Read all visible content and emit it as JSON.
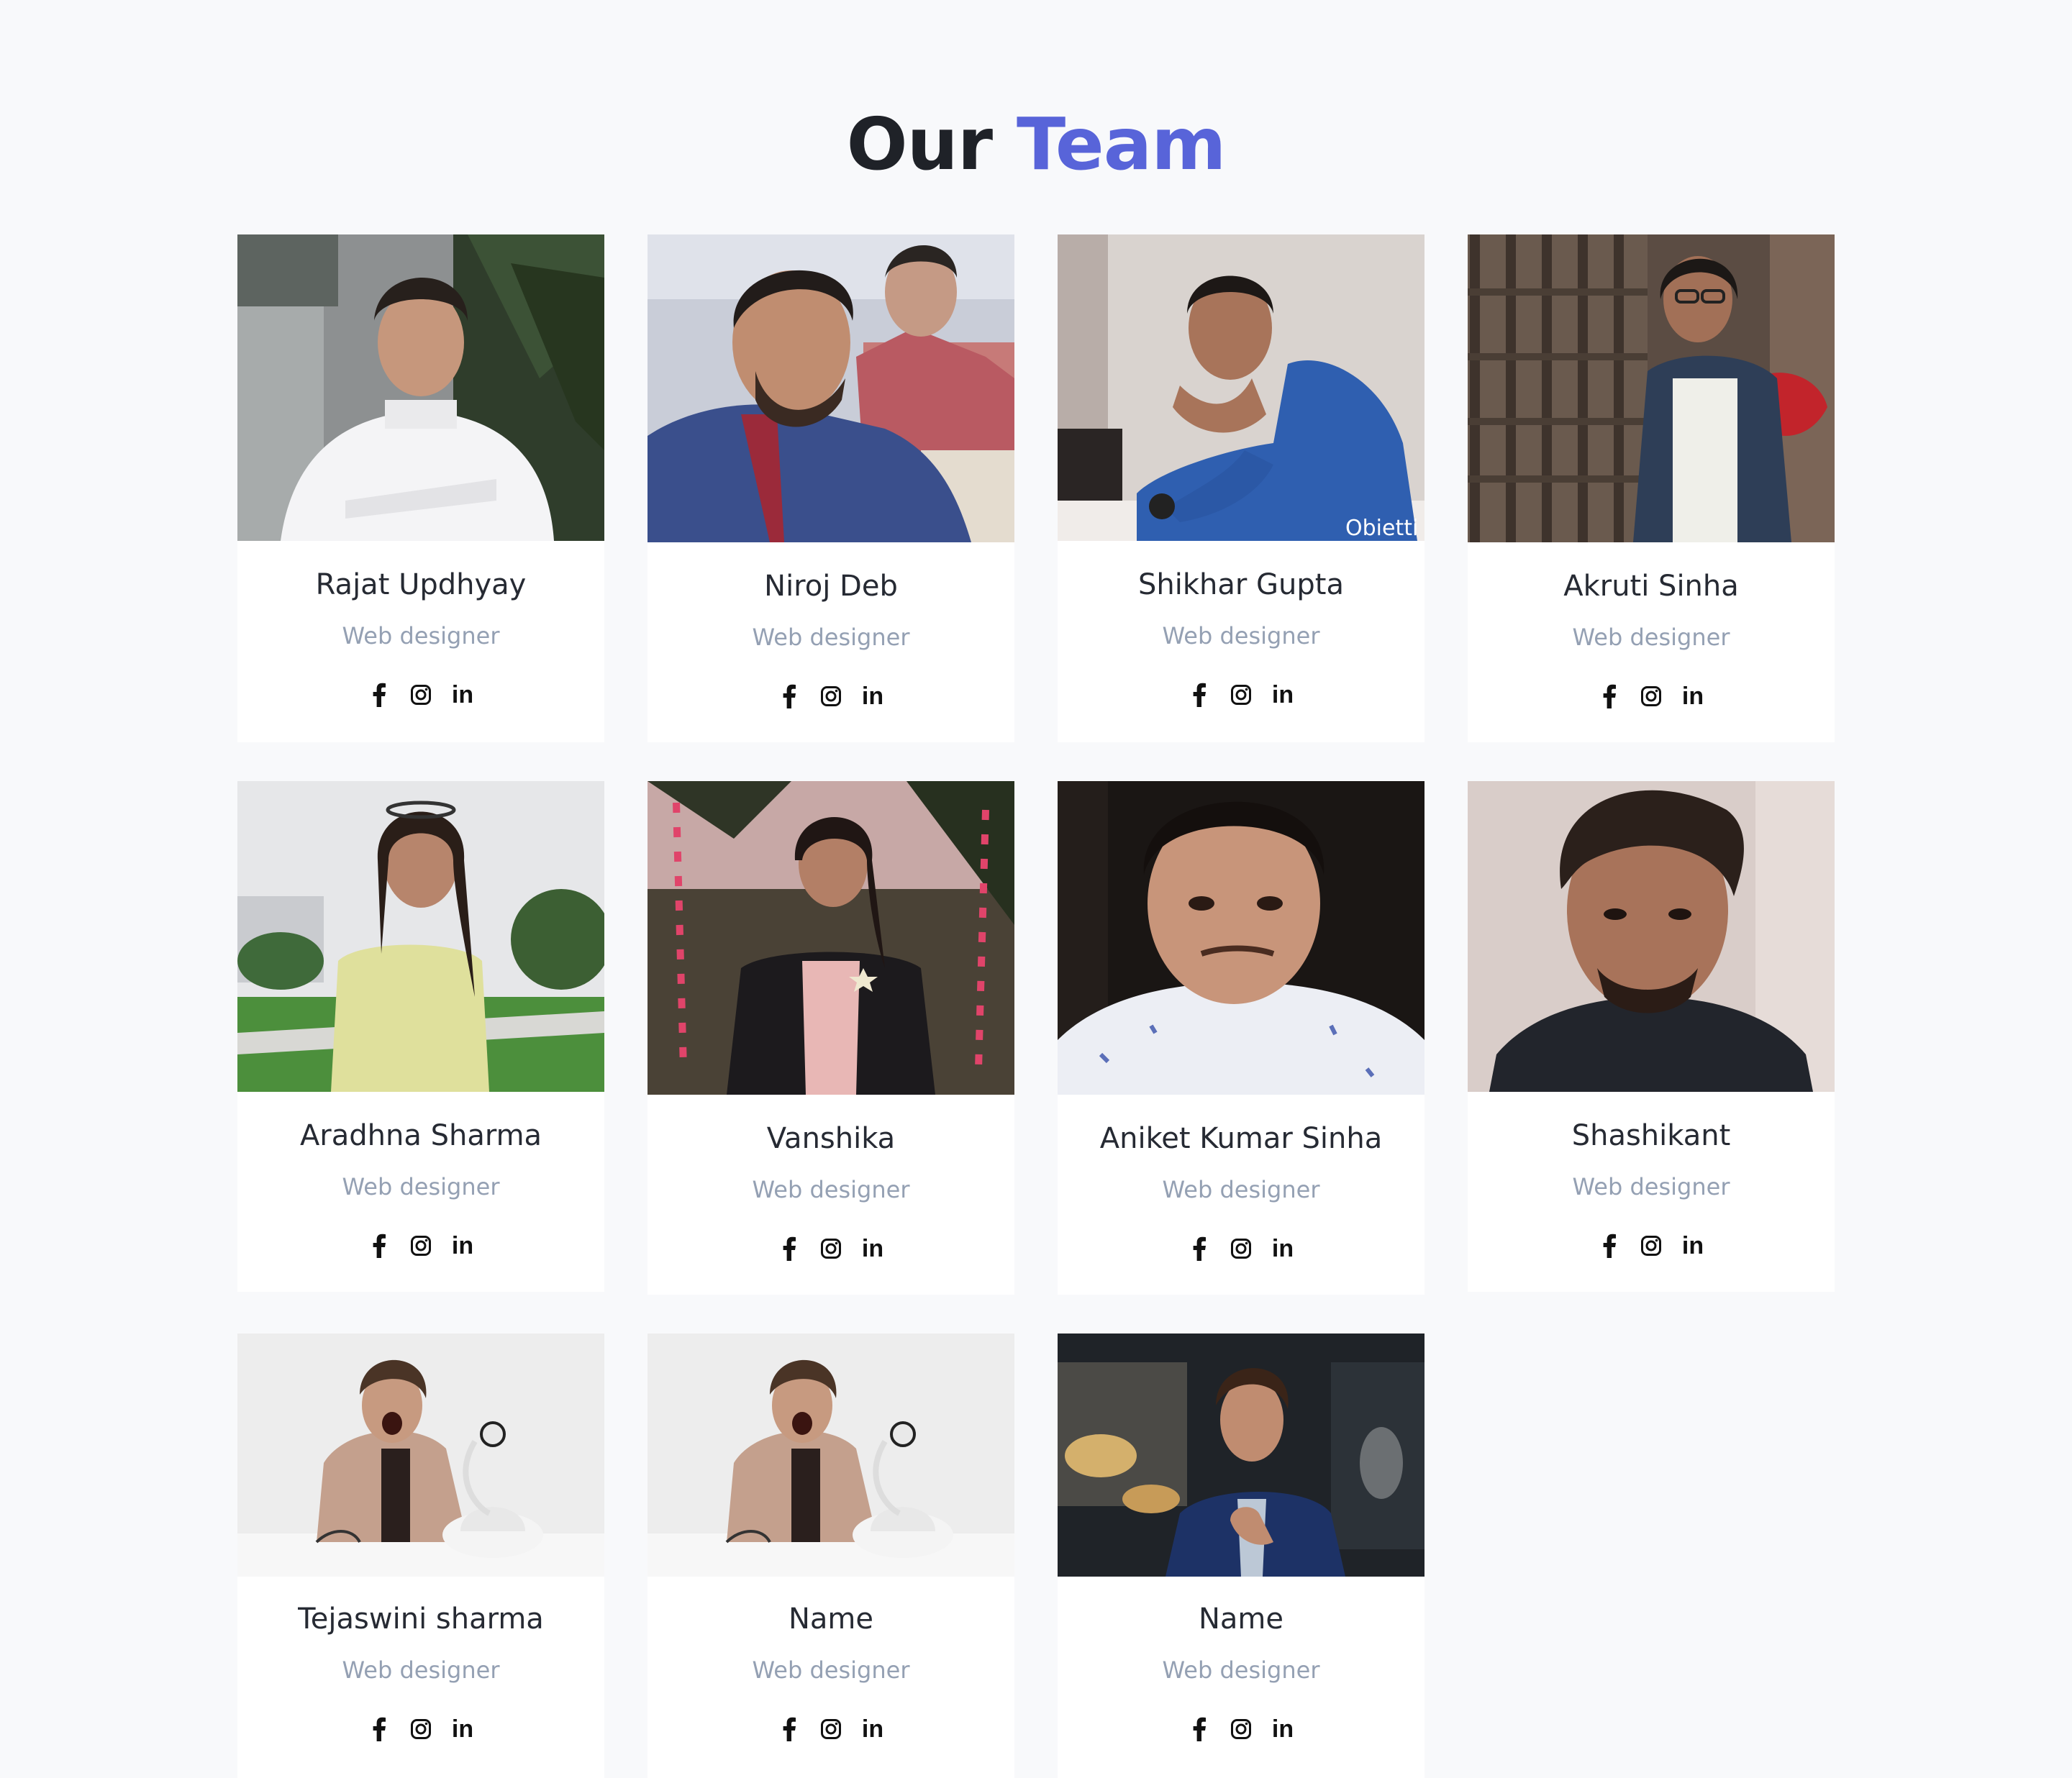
{
  "header": {
    "title_part1": "Our",
    "title_part2": "Team",
    "accent_color": "#5864d9"
  },
  "team": [
    {
      "name": "Rajat Updhyay",
      "role": "Web designer",
      "photo": "man-white-shirt-outdoors"
    },
    {
      "name": "Niroj Deb",
      "role": "Web designer",
      "photo": "man-blue-shirt-classroom"
    },
    {
      "name": "Shikhar Gupta",
      "role": "Web designer",
      "photo": "man-blue-sweater-seated"
    },
    {
      "name": "Akruti Sinha",
      "role": "Web designer",
      "photo": "woman-denim-jacket-museum"
    },
    {
      "name": "Aradhna Sharma",
      "role": "Web designer",
      "photo": "woman-yellow-top-park"
    },
    {
      "name": "Vanshika",
      "role": "Web designer",
      "photo": "woman-black-blazer-night"
    },
    {
      "name": "Aniket Kumar Sinha",
      "role": "Web designer",
      "photo": "man-white-shirt-selfie"
    },
    {
      "name": "Shashikant",
      "role": "Web designer",
      "photo": "man-dark-tshirt-portrait"
    },
    {
      "name": "Tejaswini sharma",
      "role": "Web designer",
      "photo": "man-shouting-telephone"
    },
    {
      "name": "Name",
      "role": "Web designer",
      "photo": "man-shouting-telephone"
    },
    {
      "name": "Name",
      "role": "Web designer",
      "photo": "man-blue-suit-city-night"
    }
  ],
  "social_icons": [
    "facebook-icon",
    "instagram-icon",
    "linkedin-icon"
  ],
  "photo_watermark": "Obietti"
}
